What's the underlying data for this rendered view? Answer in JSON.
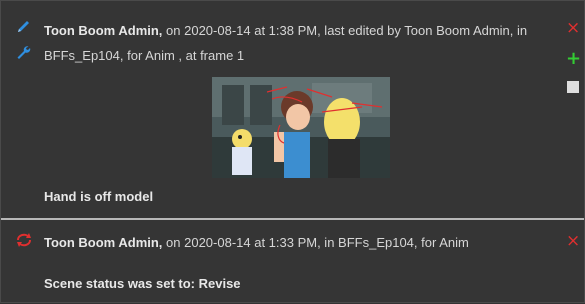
{
  "notes": [
    {
      "author": "Toon Boom Admin,",
      "meta": " on 2020-08-14 at 1:38 PM, last edited by Toon Boom Admin, in BFFs_Ep104, for Anim , at frame 1",
      "text": "Hand is off model",
      "thumbnail_alt": "Storyboard frame thumbnail with red drawing annotations"
    },
    {
      "author": "Toon Boom Admin,",
      "meta": " on 2020-08-14 at 1:33 PM, in BFFs_Ep104, for Anim",
      "text": "Scene status was set to: Revise"
    }
  ],
  "icons": {
    "pencil": "pencil-icon",
    "wrench": "wrench-icon",
    "status": "status-change-icon",
    "delete": "×",
    "add": "+"
  },
  "colors": {
    "background": "#353535",
    "delete": "#e02f2f",
    "add": "#33cc33",
    "pencil": "#2f8fe0"
  }
}
